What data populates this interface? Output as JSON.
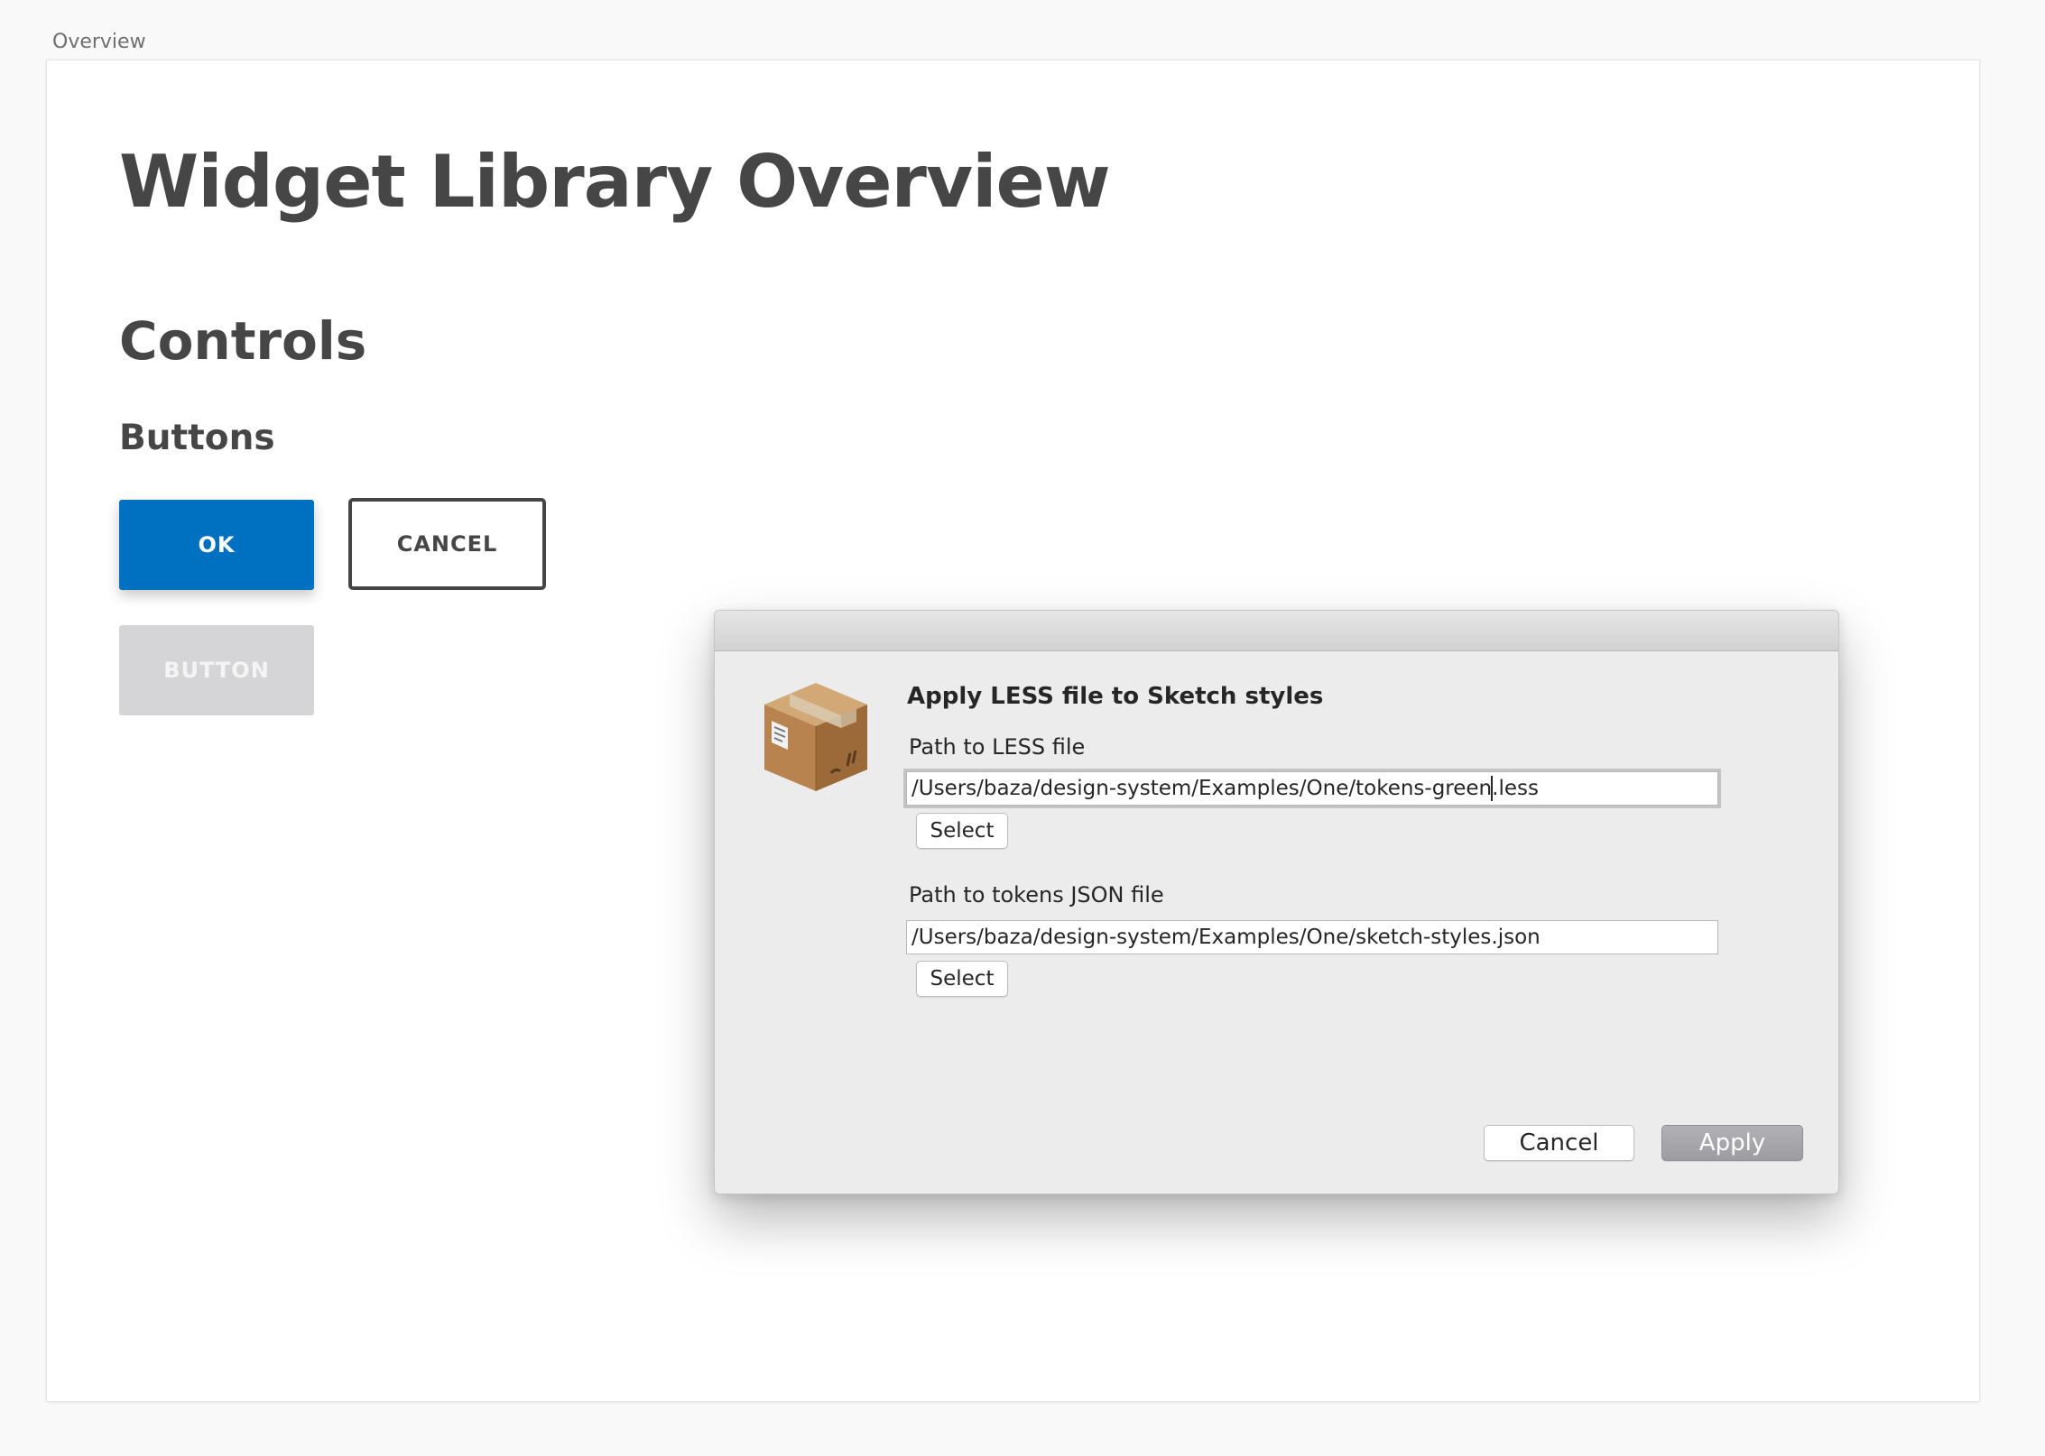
{
  "artboard": {
    "label": "Overview"
  },
  "page": {
    "title": "Widget Library Overview",
    "section": "Controls",
    "subsection": "Buttons"
  },
  "buttons_demo": {
    "ok_label": "OK",
    "cancel_label": "CANCEL",
    "disabled_label": "BUTTON"
  },
  "colors": {
    "primary": "#0070c0",
    "text_dark": "#464646",
    "disabled_bg": "#d5d5d7",
    "dialog_bg": "#ececec"
  },
  "dialog": {
    "title": "Apply LESS file to Sketch styles",
    "icon": "package-box-icon",
    "less_label": "Path to LESS file",
    "less_value_before_caret": "/Users/baza/design-system/Examples/One/tokens-green",
    "less_value_after_caret": ".less",
    "json_label": "Path to tokens JSON file",
    "json_value": "/Users/baza/design-system/Examples/One/sketch-styles.json",
    "select_label": "Select",
    "cancel_label": "Cancel",
    "apply_label": "Apply"
  }
}
